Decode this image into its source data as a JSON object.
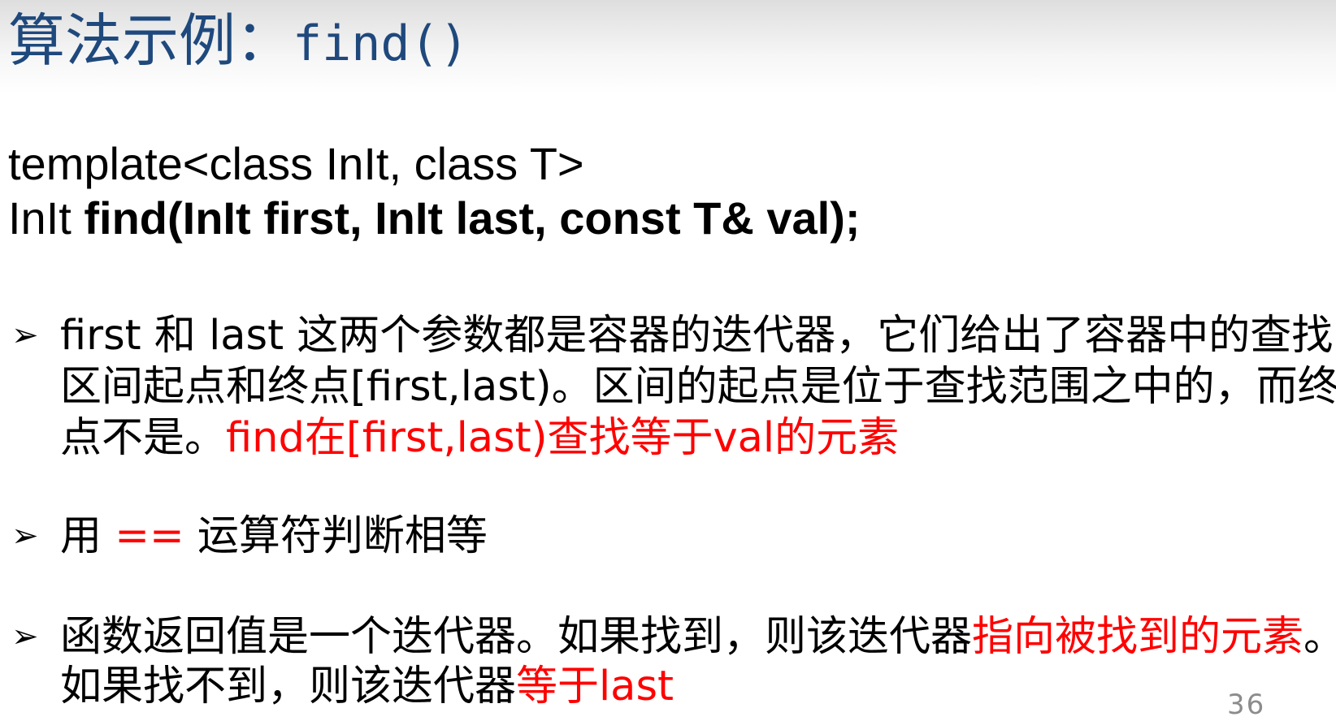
{
  "title": {
    "text": "算法示例：",
    "code": "find()"
  },
  "signature": {
    "line1": "template<class InIt, class T>",
    "line2_plain": "InIt ",
    "line2_bold": "find(InIt first, InIt last, const T& val);"
  },
  "bullets": [
    {
      "l1": "first 和 last 这两个参数都是容器的迭代器，它们给出了容器中的查找",
      "l2": "区间起点和终点[first,last)。区间的起点是位于查找范围之中的，而终",
      "l3_plain": "点不是。",
      "l3_red": "find在[first,last)查找等于val的元素"
    },
    {
      "a": "用 ",
      "b": "==",
      "c": " 运算符判断相等"
    },
    {
      "l1_plain": "函数返回值是一个迭代器。如果找到，则该迭代器",
      "l1_red": "指向被找到的元素",
      "l1_end": "。",
      "l2_plain": "如果找不到，则该迭代器",
      "l2_red": "等于last"
    }
  ],
  "bullet_symbol": "➢",
  "page_number": "36",
  "colors": {
    "title": "#1f497d",
    "highlight": "#ff0000",
    "page_number": "#8c8c8c"
  }
}
